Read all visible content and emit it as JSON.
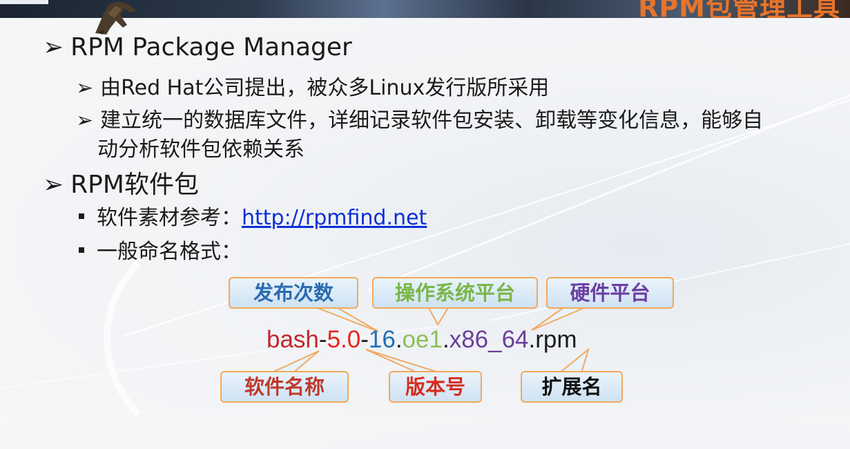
{
  "banner": {
    "title": "RPM包管理工具"
  },
  "bullets": {
    "item1": {
      "marker": "➢",
      "text": "RPM Package Manager"
    },
    "item1_sub1": {
      "marker": "➢",
      "text": "由Red Hat公司提出，被众多Linux发行版所采用"
    },
    "item1_sub2_line1": {
      "marker": "➢",
      "text": "建立统一的数据库文件，详细记录软件包安装、卸载等变化信息，能够自"
    },
    "item1_sub2_line2": {
      "text": "动分析软件包依赖关系"
    },
    "item2": {
      "marker": "➢",
      "text": "RPM软件包"
    },
    "item2_sub1": {
      "prefix": "软件素材参考：",
      "link": "http://rpmfind.net"
    },
    "item2_sub2": {
      "text": "一般命名格式："
    }
  },
  "naming": {
    "package": {
      "name": "bash",
      "sep1": "-",
      "version": "5.0",
      "sep2": "-",
      "release": "16",
      "dot1": ".",
      "os": "oe1",
      "dot2": ".",
      "arch": "x86_64",
      "ext": ".rpm"
    },
    "labels": {
      "release": "发布次数",
      "os": "操作系统平台",
      "arch": "硬件平台",
      "name": "软件名称",
      "version": "版本号",
      "ext": "扩展名"
    },
    "colors": {
      "name": "#c1272d",
      "version": "#e8231f",
      "release": "#1f6fb4",
      "os": "#8dbf5a",
      "arch": "#6a3f99",
      "ext": "#1b1b1b",
      "sep": "#1b1b1b",
      "label_release": "#2b6cb0",
      "label_os": "#7ab648",
      "label_arch": "#6b3fa0",
      "label_name": "#c0392b",
      "label_version": "#d62d20",
      "label_ext": "#111111",
      "box_border": "#f3a85c"
    }
  }
}
